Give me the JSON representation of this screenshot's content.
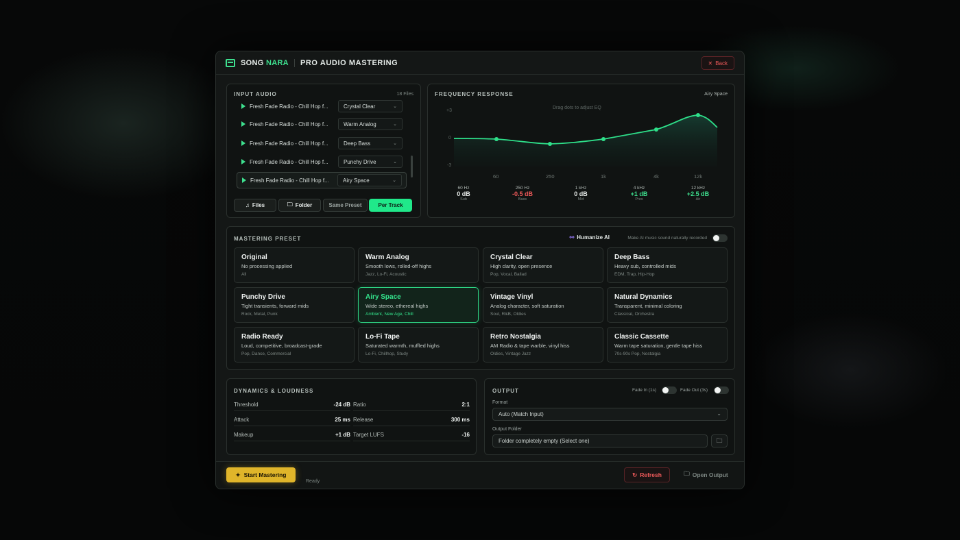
{
  "app": {
    "brand_a": "SONG ",
    "brand_b": "NARA",
    "title": "PRO AUDIO MASTERING",
    "back": "Back"
  },
  "input": {
    "title": "INPUT AUDIO",
    "count": "18 Files",
    "tracks": [
      {
        "name": "Fresh Fade Radio - Chill Hop f...",
        "preset": "Crystal Clear"
      },
      {
        "name": "Fresh Fade Radio - Chill Hop f...",
        "preset": "Warm Analog"
      },
      {
        "name": "Fresh Fade Radio - Chill Hop f...",
        "preset": "Deep Bass"
      },
      {
        "name": "Fresh Fade Radio - Chill Hop f...",
        "preset": "Punchy Drive"
      },
      {
        "name": "Fresh Fade Radio - Chill Hop f...",
        "preset": "Airy Space"
      }
    ],
    "buttons": {
      "files": "Files",
      "folder": "Folder",
      "same": "Same Preset",
      "per": "Per Track"
    }
  },
  "freq": {
    "title": "FREQUENCY RESPONSE",
    "preset": "Airy Space",
    "hint": "Drag dots to adjust EQ",
    "y_ticks": [
      "+3",
      "0",
      "-3"
    ],
    "x_ticks": [
      "60",
      "250",
      "1k",
      "4k",
      "12k"
    ],
    "bands": [
      {
        "freq": "60 Hz",
        "gain": "0 dB",
        "name": "Sub",
        "color": "#e8ecea"
      },
      {
        "freq": "250 Hz",
        "gain": "-0.5 dB",
        "name": "Bass",
        "color": "#ef5a5a"
      },
      {
        "freq": "1 kHz",
        "gain": "0 dB",
        "name": "Mid",
        "color": "#e8ecea"
      },
      {
        "freq": "4 kHz",
        "gain": "+1 dB",
        "name": "Pres",
        "color": "#3ee08f"
      },
      {
        "freq": "12 kHz",
        "gain": "+2.5 dB",
        "name": "Air",
        "color": "#3ee08f"
      }
    ]
  },
  "preset": {
    "title": "MASTERING PRESET",
    "humanize": "Humanize AI",
    "humanize_desc": "Make AI music sound naturally recorded",
    "cards": [
      {
        "n": "Original",
        "d": "No processing applied",
        "t": "All"
      },
      {
        "n": "Warm Analog",
        "d": "Smooth lows, rolled-off highs",
        "t": "Jazz, Lo-Fi, Acoustic"
      },
      {
        "n": "Crystal Clear",
        "d": "High clarity, open presence",
        "t": "Pop, Vocal, Ballad"
      },
      {
        "n": "Deep Bass",
        "d": "Heavy sub, controlled mids",
        "t": "EDM, Trap, Hip-Hop"
      },
      {
        "n": "Punchy Drive",
        "d": "Tight transients, forward mids",
        "t": "Rock, Metal, Punk"
      },
      {
        "n": "Airy Space",
        "d": "Wide stereo, ethereal highs",
        "t": "Ambient, New Age, Chill"
      },
      {
        "n": "Vintage Vinyl",
        "d": "Analog character, soft saturation",
        "t": "Soul, R&B, Oldies"
      },
      {
        "n": "Natural Dynamics",
        "d": "Transparent, minimal coloring",
        "t": "Classical, Orchestra"
      },
      {
        "n": "Radio Ready",
        "d": "Loud, competitive, broadcast-grade",
        "t": "Pop, Dance, Commercial"
      },
      {
        "n": "Lo-Fi Tape",
        "d": "Saturated warmth, muffled highs",
        "t": "Lo-Fi, Chillhop, Study"
      },
      {
        "n": "Retro Nostalgia",
        "d": "AM Radio & tape warble, vinyl hiss",
        "t": "Oldies, Vintage Jazz"
      },
      {
        "n": "Classic Cassette",
        "d": "Warm tape saturation, gentle tape hiss",
        "t": "70s-90s Pop, Nostalgia"
      }
    ]
  },
  "dyn": {
    "title": "DYNAMICS & LOUDNESS",
    "rows": [
      {
        "l": "Threshold",
        "v": "-24 dB"
      },
      {
        "l": "Ratio",
        "v": "2:1"
      },
      {
        "l": "Attack",
        "v": "25 ms"
      },
      {
        "l": "Release",
        "v": "300 ms"
      },
      {
        "l": "Makeup",
        "v": "+1 dB"
      },
      {
        "l": "Target LUFS",
        "v": "-16"
      }
    ]
  },
  "output": {
    "title": "OUTPUT",
    "fade_in": "Fade In (1s)",
    "fade_out": "Fade Out (3s)",
    "format_label": "Format",
    "format": "Auto (Match Input)",
    "folder_label": "Output Folder",
    "folder": "Folder completely empty (Select one)"
  },
  "footer": {
    "start": "Start Mastering",
    "status": "Ready",
    "refresh": "Refresh",
    "open": "Open Output"
  }
}
